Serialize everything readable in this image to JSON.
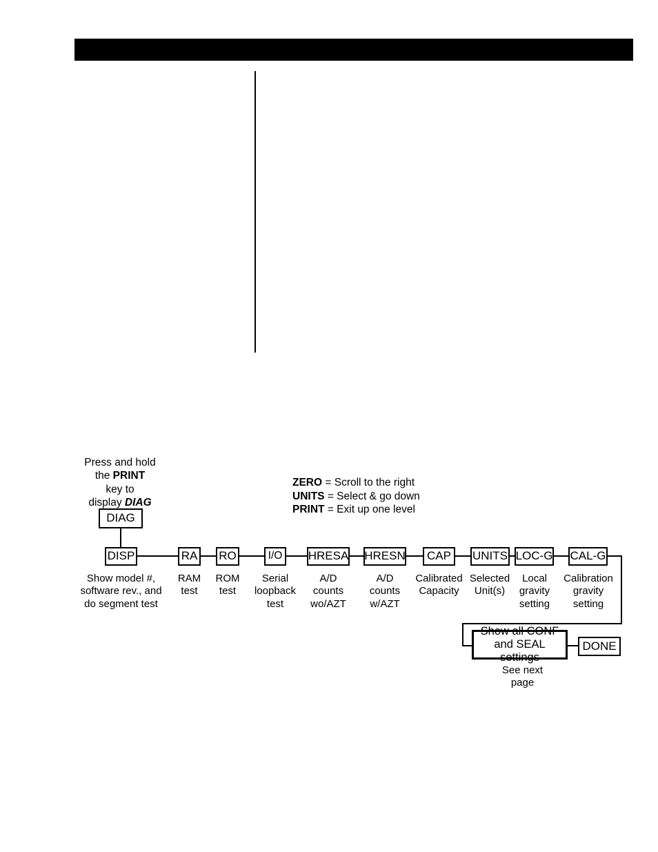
{
  "page": {
    "header_bar_color": "#000000",
    "background_color": "#ffffff",
    "text_color": "#000000"
  },
  "instructions": {
    "line1": "Press and hold",
    "line2_prefix": "the ",
    "line2_key": "PRINT",
    "line3": "key to",
    "line4_prefix": "display ",
    "line4_key": "DIAG"
  },
  "key_legend": [
    {
      "key": "ZERO",
      "separator": " = ",
      "action": "Scroll to the right"
    },
    {
      "key": "UNITS",
      "separator": " = ",
      "action": "Select & go down"
    },
    {
      "key": "PRINT",
      "separator": " = ",
      "action": "Exit up one level"
    }
  ],
  "flowchart": {
    "root": {
      "label": "DIAG"
    },
    "nodes": [
      {
        "label": "DISP",
        "caption": "Show model #,\nsoftware rev., and\ndo segment test"
      },
      {
        "label": "RA",
        "caption": "RAM\ntest"
      },
      {
        "label": "RO",
        "caption": "ROM\ntest"
      },
      {
        "label": "I/O",
        "caption": "Serial\nloopback\ntest"
      },
      {
        "label": "HRESA",
        "caption": "A/D\ncounts\nwo/AZT"
      },
      {
        "label": "HRESN",
        "caption": "A/D\ncounts\nw/AZT"
      },
      {
        "label": "CAP",
        "caption": "Calibrated\nCapacity"
      },
      {
        "label": "UNITS",
        "caption": "Selected\nUnit(s)"
      },
      {
        "label": "LOC-G",
        "caption": "Local\ngravity\nsetting"
      },
      {
        "label": "CAL-G",
        "caption": "Calibration\ngravity\nsetting"
      }
    ],
    "settings_node": {
      "label": "Show all CONF\nand SEAL settings"
    },
    "done_node": {
      "label": "DONE"
    },
    "next_page_note": "See next\npage"
  }
}
